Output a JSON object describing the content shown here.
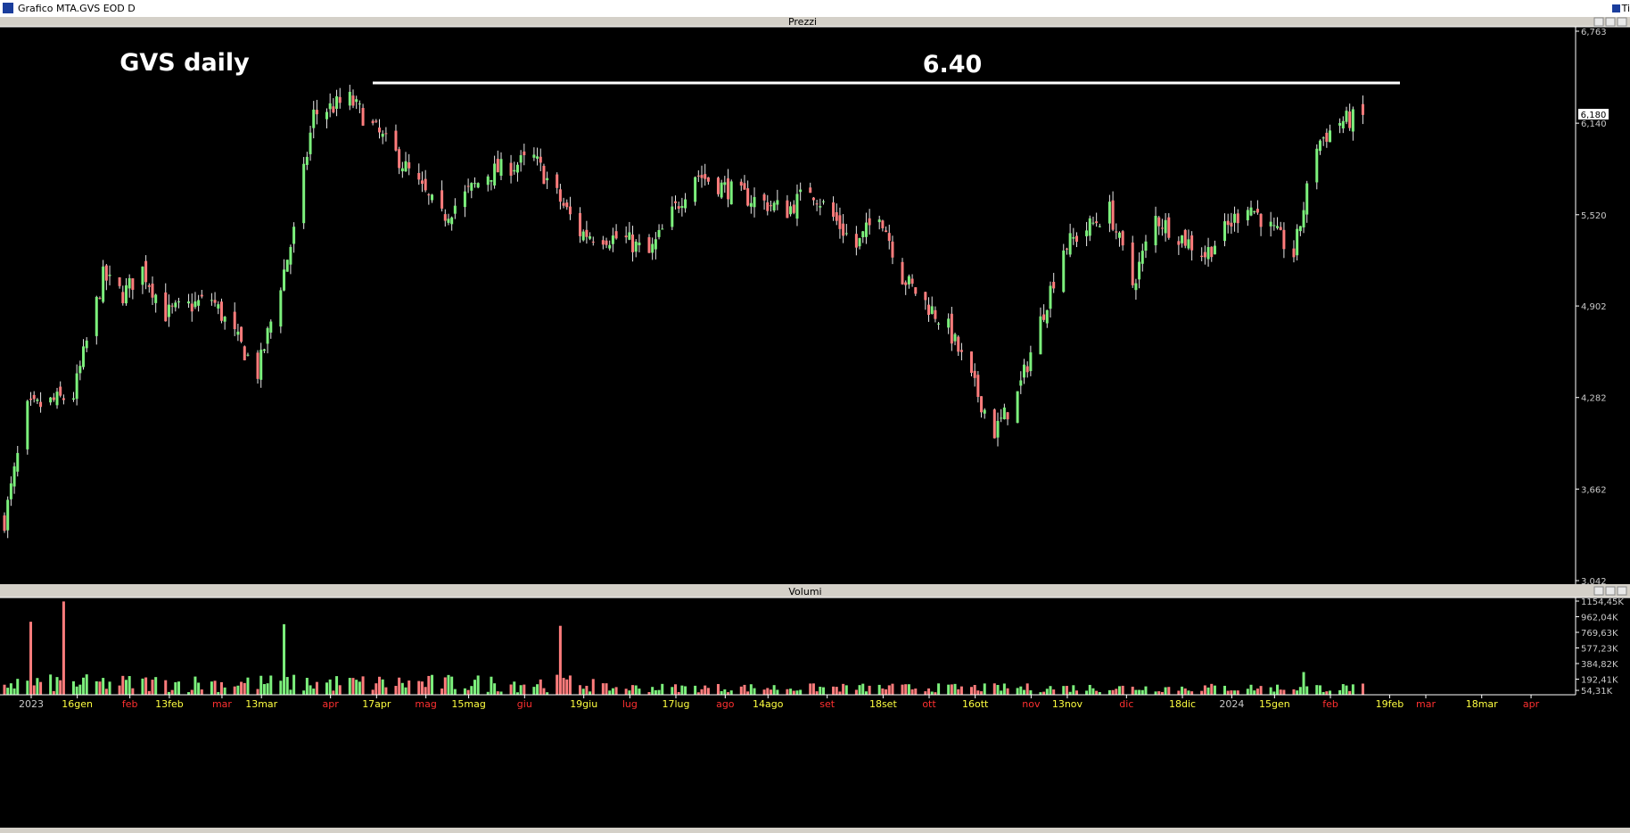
{
  "window": {
    "title": "Grafico MTA.GVS EOD D",
    "right_text": "Ti"
  },
  "price_panel": {
    "title": "Prezzi",
    "annotation_title": "GVS daily",
    "resistance_label": "6.40",
    "last_price": "6,180"
  },
  "volume_panel": {
    "title": "Volumi",
    "last_volume": "54,31K"
  },
  "colors": {
    "up": "#7cf07c",
    "down": "#ff7c7c",
    "background": "#000000",
    "axis_text": "#c8c8c8",
    "month_label": "#ff3030",
    "date_label": "#ffff40"
  },
  "chart_data": [
    {
      "type": "candlestick",
      "title": "Prezzi",
      "annotations": [
        "GVS daily",
        "6.40"
      ],
      "resistance_level": 6.4,
      "ylim": [
        3.042,
        6.763
      ],
      "y_ticks": [
        "6,763",
        "6,140",
        "5,520",
        "4,902",
        "4,282",
        "3,662",
        "3,042"
      ],
      "y_tick_values": [
        6.763,
        6.14,
        5.52,
        4.902,
        4.282,
        3.662,
        3.042
      ],
      "last_price": 6.18,
      "x_labels": [
        {
          "text": "2023",
          "kind": "year"
        },
        {
          "text": "16gen",
          "kind": "date"
        },
        {
          "text": "feb",
          "kind": "month"
        },
        {
          "text": "13feb",
          "kind": "date"
        },
        {
          "text": "mar",
          "kind": "month"
        },
        {
          "text": "13mar",
          "kind": "date"
        },
        {
          "text": "apr",
          "kind": "month"
        },
        {
          "text": "17apr",
          "kind": "date"
        },
        {
          "text": "mag",
          "kind": "month"
        },
        {
          "text": "15mag",
          "kind": "date"
        },
        {
          "text": "giu",
          "kind": "month"
        },
        {
          "text": "19giu",
          "kind": "date"
        },
        {
          "text": "lug",
          "kind": "month"
        },
        {
          "text": "17lug",
          "kind": "date"
        },
        {
          "text": "ago",
          "kind": "month"
        },
        {
          "text": "14ago",
          "kind": "date"
        },
        {
          "text": "set",
          "kind": "month"
        },
        {
          "text": "18set",
          "kind": "date"
        },
        {
          "text": "ott",
          "kind": "month"
        },
        {
          "text": "16ott",
          "kind": "date"
        },
        {
          "text": "nov",
          "kind": "month"
        },
        {
          "text": "13nov",
          "kind": "date"
        },
        {
          "text": "dic",
          "kind": "month"
        },
        {
          "text": "18dic",
          "kind": "date"
        },
        {
          "text": "2024",
          "kind": "year"
        },
        {
          "text": "15gen",
          "kind": "date"
        },
        {
          "text": "feb",
          "kind": "month"
        },
        {
          "text": "19feb",
          "kind": "date"
        },
        {
          "text": "mar",
          "kind": "month"
        },
        {
          "text": "18mar",
          "kind": "date"
        },
        {
          "text": "apr",
          "kind": "month"
        }
      ],
      "trend_close": [
        {
          "date": "2023-01-02",
          "close": 3.45
        },
        {
          "date": "2023-01-09",
          "close": 4.2
        },
        {
          "date": "2023-01-23",
          "close": 4.3
        },
        {
          "date": "2023-02-01",
          "close": 5.1
        },
        {
          "date": "2023-02-07",
          "close": 4.98
        },
        {
          "date": "2023-02-13",
          "close": 5.15
        },
        {
          "date": "2023-02-20",
          "close": 4.85
        },
        {
          "date": "2023-03-06",
          "close": 4.95
        },
        {
          "date": "2023-03-20",
          "close": 4.45
        },
        {
          "date": "2023-03-31",
          "close": 5.4
        },
        {
          "date": "2023-04-06",
          "close": 6.2
        },
        {
          "date": "2023-04-17",
          "close": 6.3
        },
        {
          "date": "2023-05-02",
          "close": 5.9
        },
        {
          "date": "2023-05-15",
          "close": 5.5
        },
        {
          "date": "2023-05-29",
          "close": 5.8
        },
        {
          "date": "2023-06-12",
          "close": 5.9
        },
        {
          "date": "2023-06-26",
          "close": 5.4
        },
        {
          "date": "2023-07-10",
          "close": 5.35
        },
        {
          "date": "2023-07-17",
          "close": 5.25
        },
        {
          "date": "2023-07-31",
          "close": 5.8
        },
        {
          "date": "2023-08-14",
          "close": 5.65
        },
        {
          "date": "2023-08-28",
          "close": 5.55
        },
        {
          "date": "2023-09-04",
          "close": 5.7
        },
        {
          "date": "2023-09-18",
          "close": 5.3
        },
        {
          "date": "2023-09-25",
          "close": 5.55
        },
        {
          "date": "2023-10-02",
          "close": 5.1
        },
        {
          "date": "2023-10-16",
          "close": 4.75
        },
        {
          "date": "2023-10-30",
          "close": 4.05
        },
        {
          "date": "2023-11-06",
          "close": 4.3
        },
        {
          "date": "2023-11-13",
          "close": 4.8
        },
        {
          "date": "2023-11-20",
          "close": 5.3
        },
        {
          "date": "2023-12-04",
          "close": 5.55
        },
        {
          "date": "2023-12-11",
          "close": 5.05
        },
        {
          "date": "2023-12-18",
          "close": 5.5
        },
        {
          "date": "2024-01-02",
          "close": 5.25
        },
        {
          "date": "2024-01-15",
          "close": 5.6
        },
        {
          "date": "2024-01-29",
          "close": 5.25
        },
        {
          "date": "2024-02-05",
          "close": 6.0
        },
        {
          "date": "2024-02-12",
          "close": 6.15
        },
        {
          "date": "2024-02-19",
          "close": 6.18
        }
      ]
    },
    {
      "type": "bar",
      "title": "Volumi",
      "ylim": [
        0,
        1154.45
      ],
      "y_ticks": [
        "1154,45K",
        "962,04K",
        "769,63K",
        "577,23K",
        "384,82K",
        "192,41K",
        "54,31K"
      ],
      "y_tick_values": [
        1154.45,
        962.04,
        769.63,
        577.23,
        384.82,
        192.41,
        54.31
      ],
      "unit": "K",
      "volume_spikes": [
        {
          "date": "2023-01-10",
          "volume": 900
        },
        {
          "date": "2023-01-20",
          "volume": 1150
        },
        {
          "date": "2023-03-28",
          "volume": 870
        },
        {
          "date": "2023-06-20",
          "volume": 850
        },
        {
          "date": "2024-02-01",
          "volume": 280
        }
      ]
    }
  ]
}
